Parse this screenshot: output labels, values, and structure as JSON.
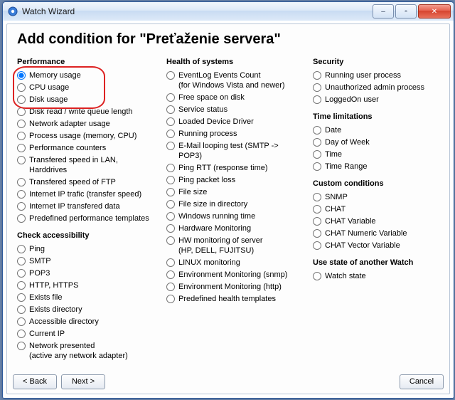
{
  "window": {
    "title": "Watch Wizard",
    "controls": {
      "min": "–",
      "max": "▫",
      "close": "✕"
    }
  },
  "page_title": "Add condition for \"Preťaženie servera\"",
  "columns": {
    "performance": {
      "heading": "Performance",
      "items": [
        "Memory usage",
        "CPU usage",
        "Disk usage",
        "Disk read / write queue length",
        "Network adapter usage",
        "Process usage (memory, CPU)",
        "Performance counters",
        "Transfered speed in LAN, Harddrives",
        "Transfered speed of FTP",
        "Internet IP trafic (transfer speed)",
        "Internet IP transfered data",
        "Predefined performance templates"
      ],
      "selected_index": 0
    },
    "check_accessibility": {
      "heading": "Check accessibility",
      "items": [
        "Ping",
        "SMTP",
        "POP3",
        "HTTP, HTTPS",
        "Exists file",
        "Exists directory",
        "Accessible directory",
        "Current IP",
        "Network presented\n(active any network adapter)"
      ]
    },
    "health": {
      "heading": "Health of systems",
      "items": [
        "EventLog Events Count\n(for Windows Vista and newer)",
        "Free space on disk",
        "Service status",
        "Loaded Device Driver",
        "Running process",
        "E-Mail looping test (SMTP -> POP3)",
        "Ping RTT (response time)",
        "Ping packet loss",
        "File size",
        "File size in directory",
        "Windows running time",
        "Hardware Monitoring",
        "HW monitoring of server\n(HP, DELL, FUJITSU)",
        "LINUX monitoring",
        "Environment Monitoring (snmp)",
        "Environment Monitoring (http)",
        "Predefined health templates"
      ]
    },
    "security": {
      "heading": "Security",
      "items": [
        "Running user process",
        "Unauthorized admin process",
        "LoggedOn user"
      ]
    },
    "time_limitations": {
      "heading": "Time limitations",
      "items": [
        "Date",
        "Day of Week",
        "Time",
        "Time Range"
      ]
    },
    "custom": {
      "heading": "Custom conditions",
      "items": [
        "SNMP",
        "CHAT",
        "CHAT Variable",
        "CHAT Numeric Variable",
        "CHAT Vector Variable"
      ]
    },
    "another_watch": {
      "heading": "Use state of another Watch",
      "items": [
        "Watch state"
      ]
    }
  },
  "footer": {
    "back": "< Back",
    "next": "Next >",
    "cancel": "Cancel"
  },
  "highlight": {
    "visible": true
  }
}
